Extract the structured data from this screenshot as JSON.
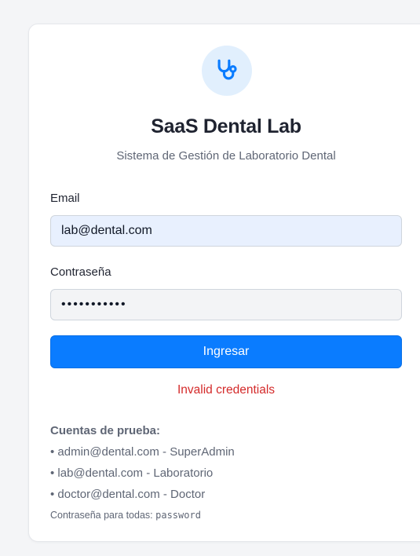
{
  "app": {
    "title": "SaaS Dental Lab",
    "subtitle": "Sistema de Gestión de Laboratorio Dental",
    "logo_icon": "stethoscope-icon",
    "accent_color": "#0a7cff"
  },
  "form": {
    "email_label": "Email",
    "email_value": "lab@dental.com",
    "password_label": "Contraseña",
    "password_value": "•••••••••••",
    "submit_label": "Ingresar",
    "error_message": "Invalid credentials"
  },
  "test_accounts": {
    "title": "Cuentas de prueba:",
    "items": [
      "• admin@dental.com - SuperAdmin",
      "• lab@dental.com - Laboratorio",
      "• doctor@dental.com - Doctor"
    ],
    "note_prefix": "Contraseña para todas: ",
    "note_password": "password"
  }
}
